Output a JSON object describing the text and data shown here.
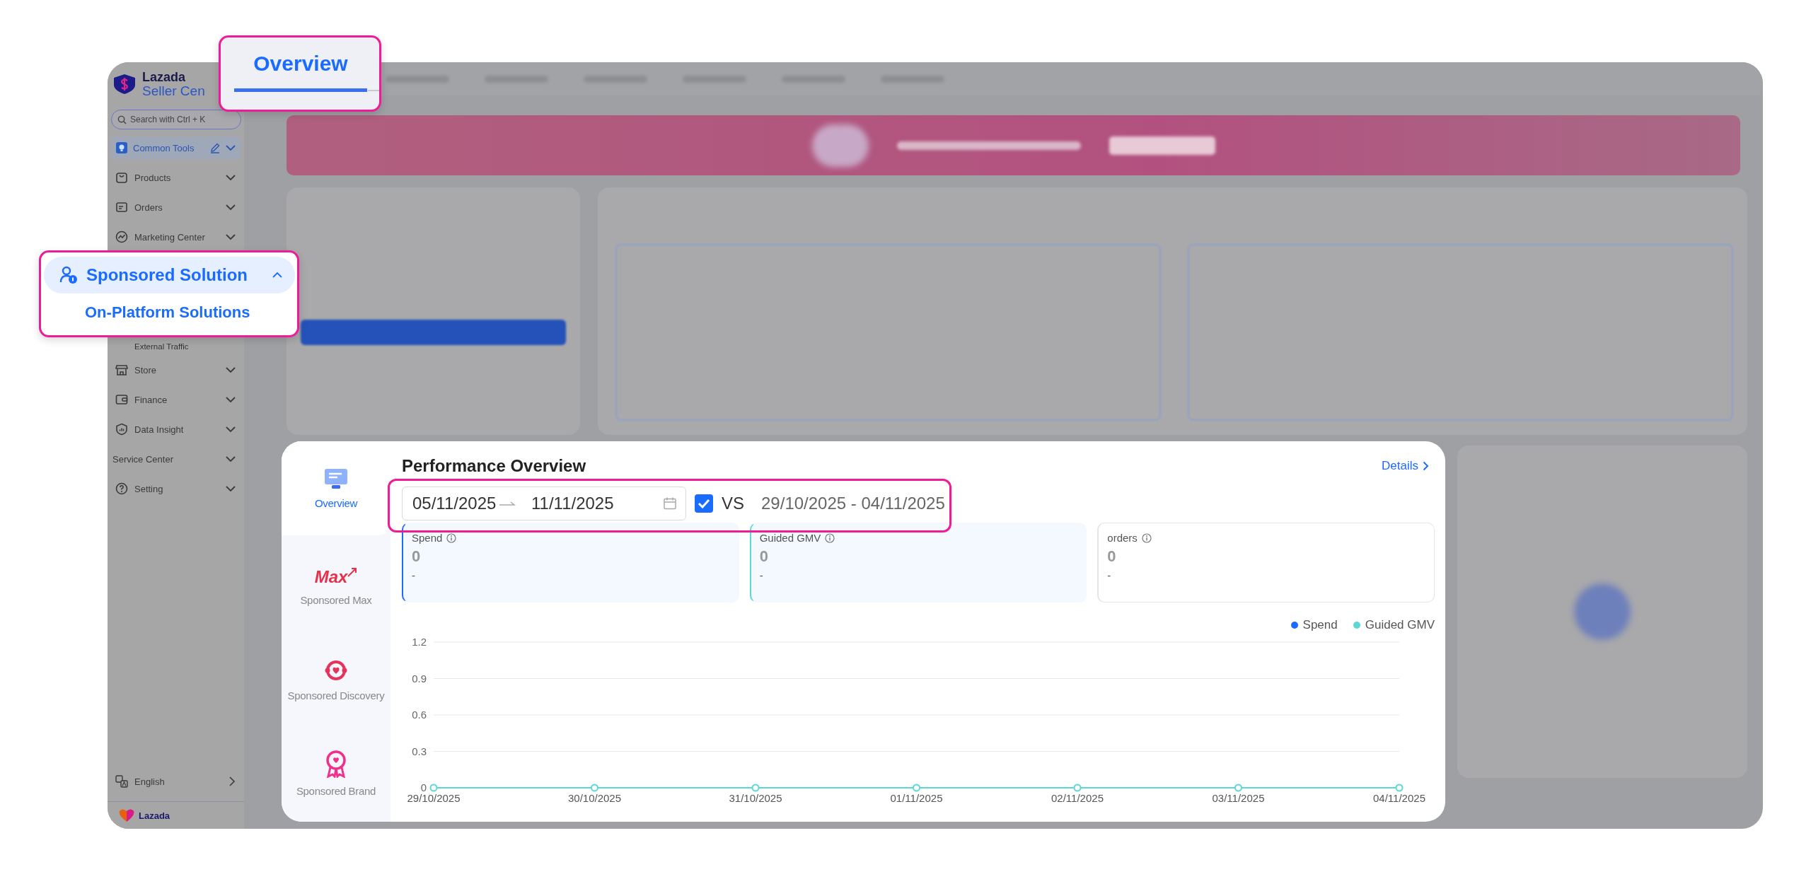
{
  "sidebar": {
    "brand": "Lazada",
    "brand_sub": "Seller Cen",
    "search": {
      "placeholder": "Search with Ctrl + K"
    },
    "items": [
      {
        "label": "Common Tools",
        "kind": "pinned",
        "expanded": false
      },
      {
        "label": "Products",
        "kind": "group",
        "expanded": false
      },
      {
        "label": "Orders",
        "kind": "group",
        "expanded": false
      },
      {
        "label": "Marketing Center",
        "kind": "group",
        "expanded": false
      },
      {
        "label": "External Traffic",
        "kind": "sub"
      },
      {
        "label": "Store",
        "kind": "group",
        "expanded": false
      },
      {
        "label": "Finance",
        "kind": "group",
        "expanded": false
      },
      {
        "label": "Data Insight",
        "kind": "group",
        "expanded": false
      },
      {
        "label": "Service Center",
        "kind": "section",
        "expanded": false
      },
      {
        "label": "Setting",
        "kind": "group",
        "expanded": false
      }
    ],
    "language": "English",
    "footer_brand": "Lazada"
  },
  "tab_callout": {
    "label": "Overview",
    "selected": true
  },
  "menu_callout": {
    "label": "Sponsored Solution",
    "expanded": true,
    "children": [
      {
        "label": "On-Platform Solutions",
        "selected": true
      }
    ]
  },
  "performance": {
    "tabs": [
      {
        "label": "Overview",
        "selected": true
      },
      {
        "label": "Sponsored Max",
        "logo_text": "Max",
        "selected": false
      },
      {
        "label": "Sponsored Discovery",
        "selected": false
      },
      {
        "label": "Sponsored Brand",
        "selected": false
      }
    ],
    "title": "Performance Overview",
    "details_link": "Details",
    "date_range": {
      "start": "05/11/2025",
      "end": "11/11/2025"
    },
    "compare": {
      "checked": true,
      "label": "VS",
      "range": "29/10/2025 - 04/11/2025"
    },
    "metrics": [
      {
        "label": "Spend",
        "value": "0",
        "change": "-",
        "selected": true
      },
      {
        "label": "Guided GMV",
        "value": "0",
        "change": "-",
        "selected": true
      },
      {
        "label": "orders",
        "value": "0",
        "change": "-",
        "selected": false
      }
    ],
    "chart_data": {
      "type": "line",
      "categories": [
        "29/10/2025",
        "30/10/2025",
        "31/10/2025",
        "01/11/2025",
        "02/11/2025",
        "03/11/2025",
        "04/11/2025"
      ],
      "series": [
        {
          "name": "Spend",
          "color": "#1a6bff",
          "values": [
            null,
            null,
            null,
            null,
            null,
            null,
            null
          ]
        },
        {
          "name": "Guided GMV",
          "color": "#5ad8d8",
          "marker": true,
          "values": [
            0,
            0,
            0,
            0,
            0,
            0,
            0
          ]
        }
      ],
      "ylim": [
        0,
        1.2
      ],
      "yticks": [
        0,
        0.3,
        0.6,
        0.9,
        1.2
      ],
      "grid": true
    }
  }
}
